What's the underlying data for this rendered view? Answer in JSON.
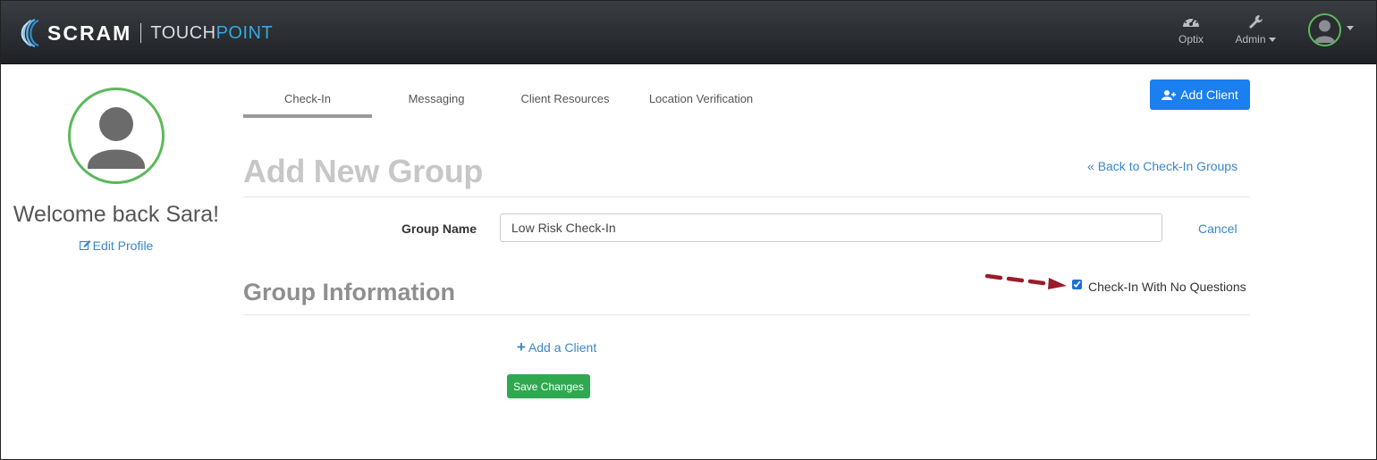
{
  "brand": {
    "name": "SCRAM",
    "product_prefix": "TOUCH",
    "product_suffix": "POINT",
    "accent": "#36a9e1"
  },
  "navbar": {
    "optix_label": "Optix",
    "admin_label": "Admin",
    "optix_icon": "speedometer-icon",
    "admin_icon": "wrench-icon",
    "user_icon": "user-avatar-icon"
  },
  "sidebar": {
    "welcome": "Welcome back Sara!",
    "edit_profile": "Edit Profile",
    "avatar_border": "#5cb85c"
  },
  "tabs": [
    {
      "label": "Check-In",
      "active": true
    },
    {
      "label": "Messaging",
      "active": false
    },
    {
      "label": "Client Resources",
      "active": false
    },
    {
      "label": "Location Verification",
      "active": false
    }
  ],
  "actions": {
    "add_client": "Add Client",
    "add_client_color": "#1a7ff0"
  },
  "page": {
    "title": "Add New Group",
    "back_link": "Back to Check-In Groups",
    "group_name_label": "Group Name",
    "group_name_value": "Low Risk Check-In",
    "cancel": "Cancel",
    "section_title": "Group Information",
    "checkin_no_questions_label": "Check-In With No Questions",
    "checkin_no_questions_checked": true,
    "add_a_client": "Add a Client",
    "save_changes": "Save Changes",
    "save_color": "#2fa84f"
  }
}
